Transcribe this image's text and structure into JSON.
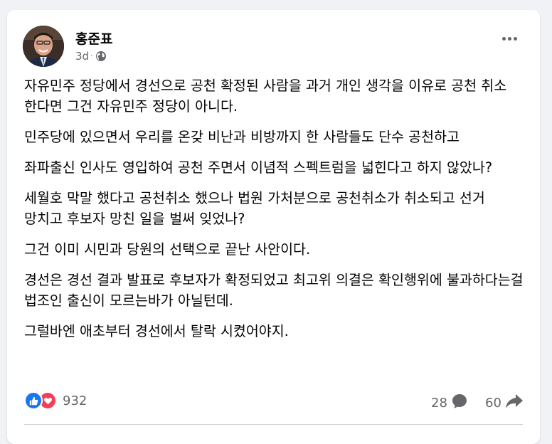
{
  "post": {
    "author": "홍준표",
    "time": "3d",
    "visibility_icon": "globe-icon",
    "paragraphs": [
      "자유민주 정당에서 경선으로 공천 확정된 사람을 과거 개인 생각을 이유로 공천 취소 한다면 그건 자유민주 정당이 아니다.",
      "민주당에 있으면서 우리를 온갖 비난과 비방까지 한 사람들도 단수 공천하고",
      "좌파출신 인사도 영입하여 공천 주면서 이념적 스펙트럼을 넓힌다고 하지 않았나?",
      "세월호 막말 했다고 공천취소 했으나 법원 가처분으로 공천취소가 취소되고 선거 망치고 후보자 망친 일을 벌써 잊었나?",
      "그건 이미 시민과 당원의 선택으로 끝난 사안이다.",
      "경선은 경선 결과 발표로 후보자가 확정되었고 최고위 의결은 확인행위에 불과하다는걸 법조인 출신이 모르는바가 아닐턴데.",
      "그럴바엔 애초부터 경선에서 탈락 시켰어야지."
    ]
  },
  "stats": {
    "reactions_count": "932",
    "comments_count": "28",
    "shares_count": "60"
  },
  "colors": {
    "like": "#1877f2",
    "love": "#f33e58",
    "secondary_text": "#65676b"
  }
}
